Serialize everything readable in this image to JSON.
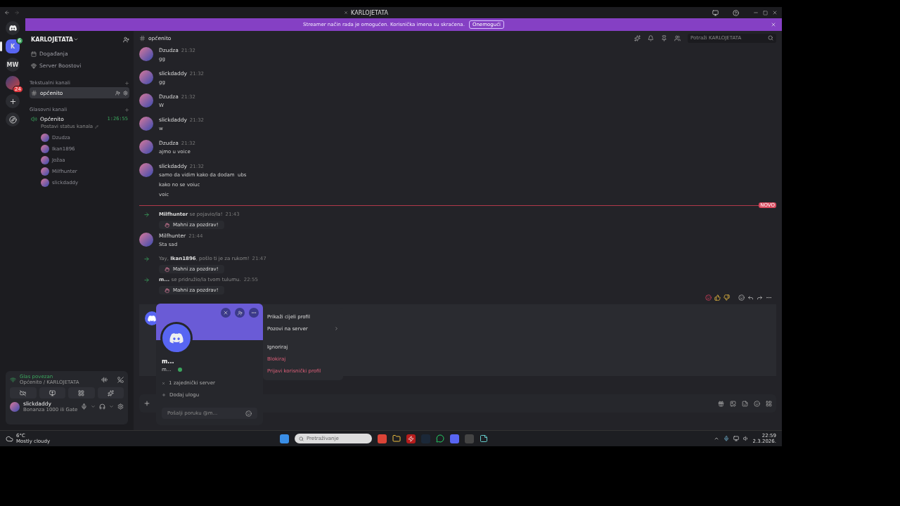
{
  "titlebar": {
    "title": "KARLOJETATA"
  },
  "banner": {
    "text": "Streamer način rada je omogućen. Korisnička imena su skraćena.",
    "button": "Onemogući"
  },
  "servers": [
    {
      "kind": "letter",
      "label": "K",
      "badge": "6",
      "selected": true
    },
    {
      "kind": "letter",
      "label": "MW",
      "selected": false
    },
    {
      "kind": "image",
      "badge": "24",
      "selected": false
    }
  ],
  "server_header": {
    "name": "KARLOJETATA"
  },
  "nav_items": [
    {
      "kind": "events",
      "label": "Događanja"
    },
    {
      "kind": "boosts",
      "label": "Server Boostovi"
    }
  ],
  "text_category": "Tekstualni kanali",
  "text_channels": [
    {
      "name": "općenito",
      "selected": true
    }
  ],
  "voice_category": "Glasovni kanali",
  "voice_channel": {
    "name": "Općenito",
    "timer": "1:26:55",
    "status": "Postavi status kanala",
    "members": [
      "Dzudza",
      "Ikan1896",
      "Jožaa",
      "Milfhunter",
      "slickdaddy"
    ]
  },
  "voice_panel": {
    "status": "Glas povezan",
    "location": "Općenito / KARLOJETATA"
  },
  "user": {
    "name": "slickdaddy",
    "status": "Bonanza 1000 ili Gate"
  },
  "channel_header": {
    "name": "općenito",
    "search_placeholder": "Potraži KARLOJETATA"
  },
  "messages": [
    {
      "kind": "message",
      "author": "Dzudza",
      "time": "21:32",
      "lines": [
        "gg"
      ]
    },
    {
      "kind": "message",
      "author": "slickdaddy",
      "time": "21:32",
      "lines": [
        "gg"
      ]
    },
    {
      "kind": "message",
      "author": "Dzudza",
      "time": "21:32",
      "lines": [
        "W"
      ]
    },
    {
      "kind": "message",
      "author": "slickdaddy",
      "time": "21:32",
      "lines": [
        "w"
      ]
    },
    {
      "kind": "message",
      "author": "Dzudza",
      "time": "21:32",
      "lines": [
        "ajmo u voice"
      ]
    },
    {
      "kind": "message",
      "author": "slickdaddy",
      "time": "21:32",
      "lines": [
        "samo da vidim kako da dodam  ubs",
        "kako no se voiuc",
        "voic"
      ]
    },
    {
      "kind": "divider",
      "label": "NOVO"
    },
    {
      "kind": "join",
      "text": "**Milfhunter** se pojavio/la!",
      "time": "21:43",
      "wave": "Mahni za pozdrav!"
    },
    {
      "kind": "message",
      "author": "Milfhunter",
      "time": "21:44",
      "lines": [
        "Sta sad"
      ]
    },
    {
      "kind": "join",
      "text": "Yay, **Ikan1896**, pošlo ti je za rukom!",
      "time": "21:47",
      "wave": "Mahni za pozdrav!"
    },
    {
      "kind": "join",
      "text": "**m...** se pridružio/la tvom tulumu.",
      "time": "22:55",
      "wave": "Mahni za pozdrav!"
    }
  ],
  "profile_card": {
    "display_name": "m...",
    "username": "m...",
    "mutual": "1 zajednički server",
    "add_role": "Dodaj ulogu",
    "message_placeholder": "Pošalji poruku @m..."
  },
  "context_menu": [
    {
      "kind": "normal",
      "label": "Prikaži cijeli profil"
    },
    {
      "kind": "submenu",
      "label": "Pozovi na server"
    },
    {
      "kind": "normal",
      "label": "Ignoriraj"
    },
    {
      "kind": "danger",
      "label": "Blokiraj"
    },
    {
      "kind": "danger",
      "label": "Prijavi korisnički profil"
    }
  ],
  "taskbar": {
    "weather_temp": "6°C",
    "weather_text": "Mostly cloudy",
    "search_placeholder": "Pretraživanje",
    "time": "22:59",
    "date": "2.3.2026."
  }
}
